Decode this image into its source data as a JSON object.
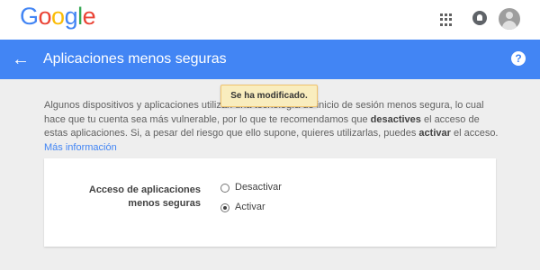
{
  "header": {
    "logo_letters": [
      "G",
      "o",
      "o",
      "g",
      "l",
      "e"
    ],
    "icons": [
      "apps-grid-icon",
      "notifications-icon",
      "account-avatar"
    ]
  },
  "appbar": {
    "back_icon": "←",
    "title": "Aplicaciones menos seguras",
    "help_icon": "?"
  },
  "toast": {
    "message": "Se ha modificado."
  },
  "description": {
    "text_1": "Algunos dispositivos y aplicaciones utilizan una tecnología de inicio de sesión menos segura, lo cual hace que tu cuenta sea más vulnerable, por lo que te recomendamos que ",
    "bold_1": "desactives",
    "text_2": " el acceso de estas aplicaciones. Si, a pesar del riesgo que ello supone, quieres utilizarlas, puedes ",
    "bold_2": "activar",
    "text_3": " el acceso. ",
    "link": "Más información"
  },
  "setting": {
    "label": "Acceso de aplicaciones menos seguras",
    "options": [
      {
        "label": "Desactivar",
        "selected": false
      },
      {
        "label": "Activar",
        "selected": true
      }
    ]
  },
  "colors": {
    "primary_blue": "#4285f4",
    "background": "#eeeeee",
    "toast_bg": "#f9edbe"
  }
}
